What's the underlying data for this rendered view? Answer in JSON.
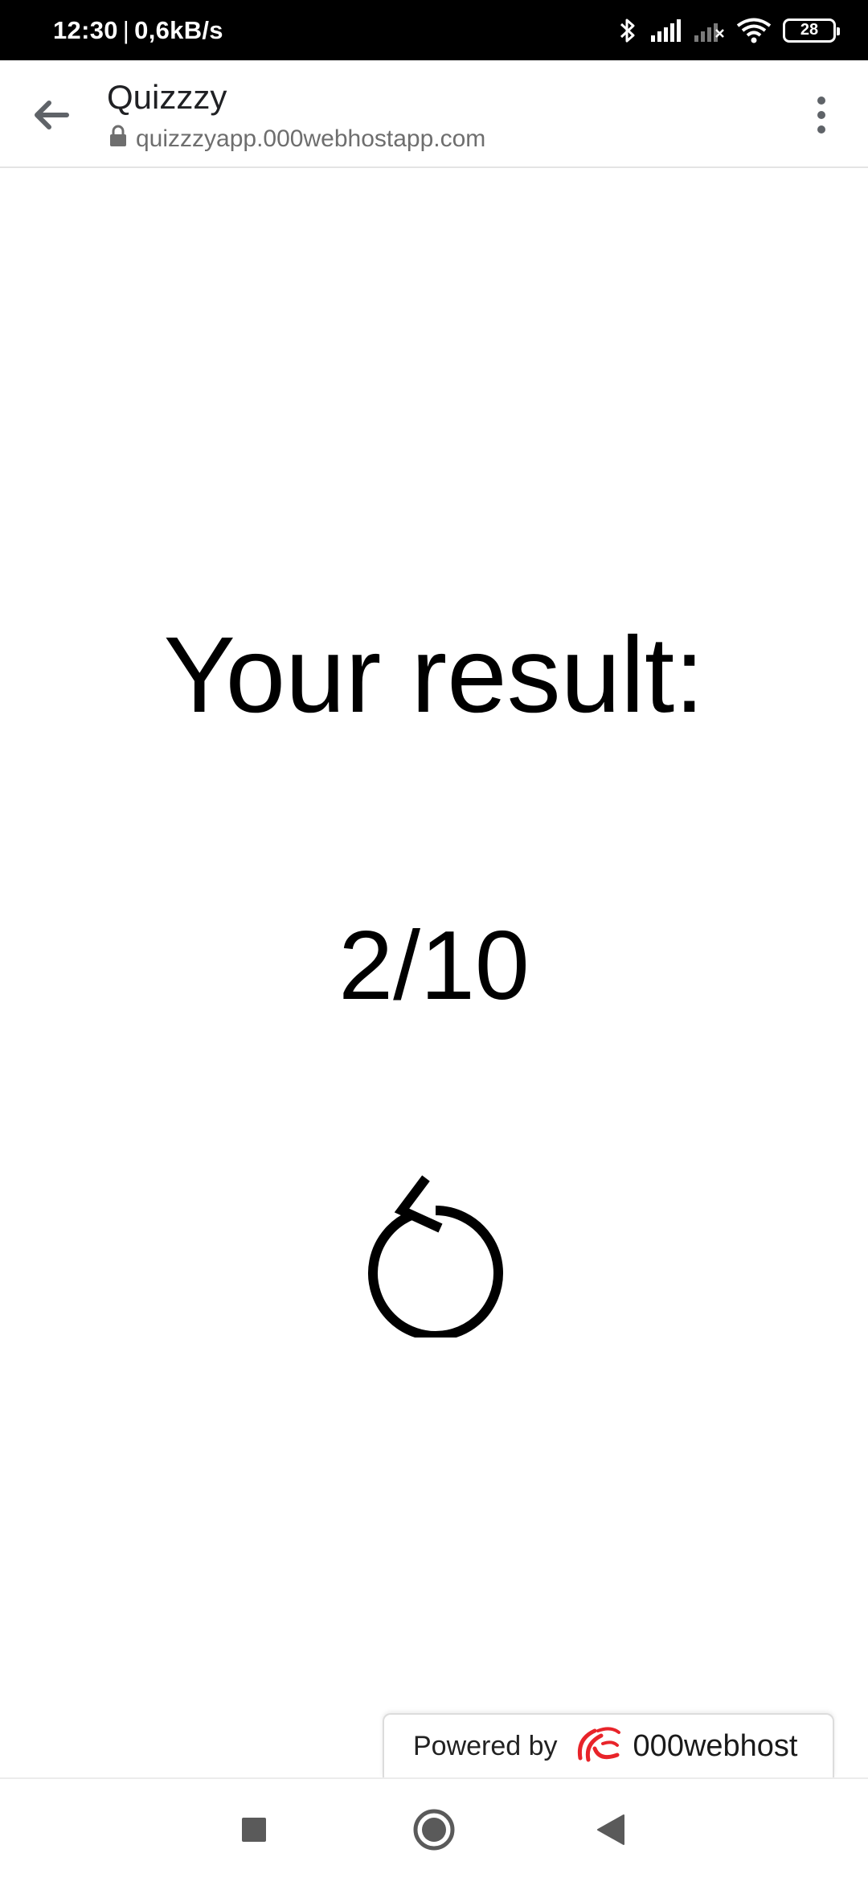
{
  "status_bar": {
    "time": "12:30",
    "separator": "|",
    "network_speed": "0,6kB/s",
    "battery_level": "28",
    "icons": [
      "bluetooth-icon",
      "signal-icon",
      "signal-no-service-icon",
      "wifi-icon",
      "battery-icon"
    ]
  },
  "browser": {
    "title": "Quizzzy",
    "url": "quizzzyapp.000webhostapp.com",
    "back_icon": "back-arrow-icon",
    "lock_icon": "lock-icon",
    "menu_icon": "more-vert-icon"
  },
  "main": {
    "title": "Your result:",
    "score": "2/10",
    "retry_icon": "replay-icon"
  },
  "footer_badge": {
    "powered_by": "Powered by",
    "brand": "000webhost",
    "brand_color": "#e8242a"
  },
  "nav_bar": {
    "icons": [
      "recents-square-icon",
      "home-circle-icon",
      "back-triangle-icon"
    ]
  }
}
